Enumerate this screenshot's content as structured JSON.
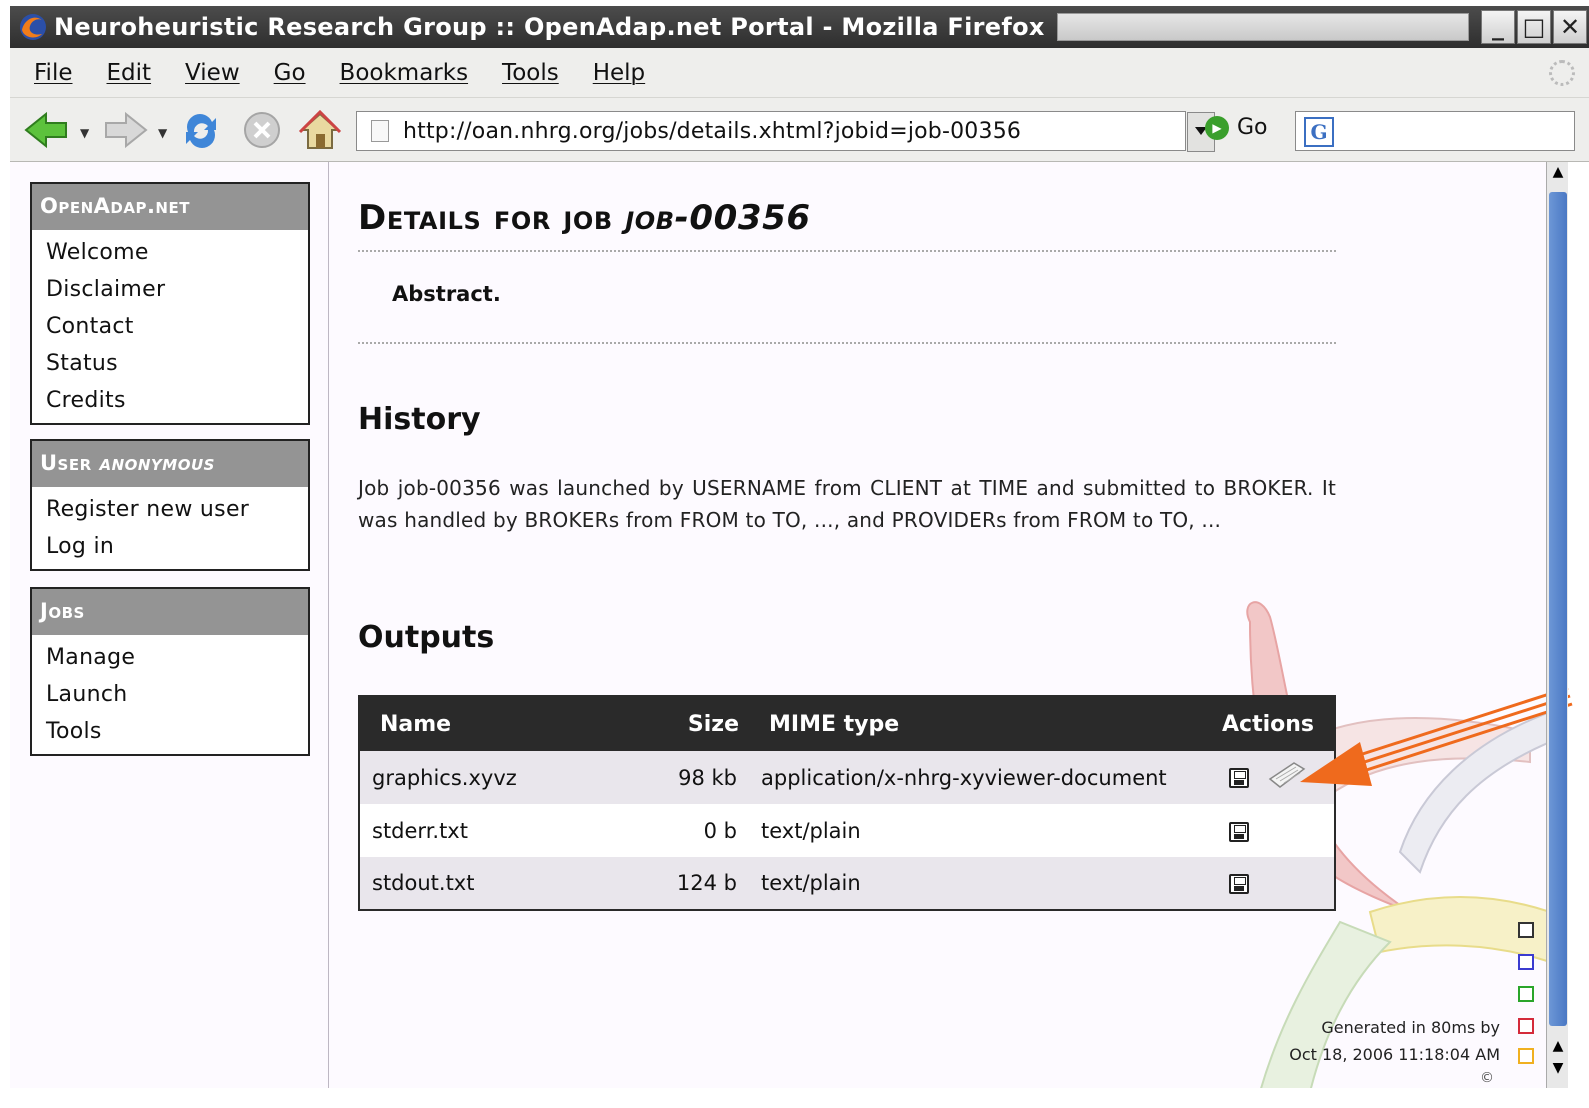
{
  "window": {
    "title": "Neuroheuristic Research Group :: OpenAdap.net Portal - Mozilla Firefox"
  },
  "menu": [
    "File",
    "Edit",
    "View",
    "Go",
    "Bookmarks",
    "Tools",
    "Help"
  ],
  "nav": {
    "url": "http://oan.nhrg.org/jobs/details.xhtml?jobid=job-00356",
    "go_label": "Go"
  },
  "sidebar": {
    "site": {
      "title": "OpenAdap.net",
      "items": [
        "Welcome",
        "Disclaimer",
        "Contact",
        "Status",
        "Credits"
      ]
    },
    "user": {
      "title_prefix": "User ",
      "title_name": "anonymous",
      "items": [
        "Register new user",
        "Log in"
      ]
    },
    "jobs": {
      "title": "Jobs",
      "items": [
        "Manage",
        "Launch",
        "Tools"
      ]
    }
  },
  "main": {
    "title_prefix": "Details for job ",
    "title_job": "job-00356",
    "abstract_label": "Abstract.",
    "history_heading": "History",
    "history_text": "Job job-00356 was launched by USERNAME from CLIENT at TIME and submitted to BROKER. It was handled by BROKERs from FROM to TO, ..., and PROVIDERs from FROM to TO, ...",
    "outputs_heading": "Outputs",
    "table": {
      "headers": [
        "Name",
        "Size",
        "MIME type",
        "Actions"
      ],
      "rows": [
        {
          "name": "graphics.xyvz",
          "size": "98 kb",
          "mime": "application/x-nhrg-xyviewer-document"
        },
        {
          "name": "stderr.txt",
          "size": "0 b",
          "mime": "text/plain"
        },
        {
          "name": "stdout.txt",
          "size": "124 b",
          "mime": "text/plain"
        }
      ]
    }
  },
  "footer": {
    "line1": "Generated in 80ms by",
    "line2": "Oct 18, 2006 11:18:04 AM",
    "copy": "©"
  },
  "colors": {
    "sidebar_head": "#949494",
    "table_head": "#2a2a2a",
    "annotation_arrow": "#ef6a1d",
    "swatches": [
      "#333333",
      "#3b3bd0",
      "#2aa52a",
      "#d42a3a",
      "#f0b020"
    ]
  }
}
